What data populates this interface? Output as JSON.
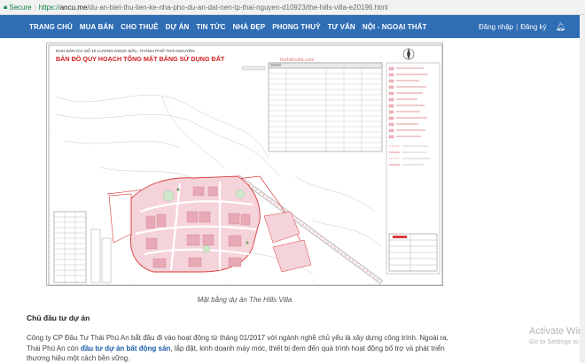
{
  "browser": {
    "secure_label": "Secure",
    "url_scheme": "https://",
    "url_host": "ancu.me",
    "url_path": "/du-an-biet-thu-lien-ke-nha-pho-du-an-dat-nen-tp-thai-nguyen-d10923/the-hills-villa-e20196.html"
  },
  "nav": {
    "items": [
      "TRANG CHỦ",
      "MUA BÁN",
      "CHO THUÊ",
      "DỰ ÁN",
      "TIN TỨC",
      "NHÀ ĐẸP",
      "PHONG THUỶ",
      "TƯ VẤN",
      "NỘI - NGOẠI THẤT"
    ],
    "login": "Đăng nhập",
    "register": "Đăng ký"
  },
  "map": {
    "header_small": "KHU DÂN CƯ SỐ 10 LƯƠNG NGỌC BẮC, THÀNH PHỐ THÁI NGUYÊN",
    "title": "BẢN ĐỒ QUY HOẠCH TỔNG MẶT BẰNG SỬ DỤNG ĐẤT",
    "watermark": "thehillsvilla.com"
  },
  "caption": "Mặt bằng dự án The Hills Villa",
  "article": {
    "section_title": "Chủ đầu tư dự án",
    "p1": "Công ty CP Đầu Tư Thái Phú An bắt đầu đi vào hoạt động từ tháng 01/2017 với ngành nghề chủ yếu là xây dựng công trình. Ngoài ra, Thái Phú An còn ",
    "link": "đầu tư dự án bất động sản",
    "p2": ", lắp đặt, kinh doanh máy móc, thiết bị đem đến quá trình hoạt động bổ trợ và phát triển thương hiệu một cách bền vững."
  },
  "os_watermark": {
    "line1": "Activate Windows",
    "line2": "Go to Settings to activate"
  },
  "colors": {
    "nav_bg": "#2f6db5",
    "map_title": "#d21f1f",
    "plot_pink": "#f3c6cf",
    "road_red": "#d83a3a"
  }
}
